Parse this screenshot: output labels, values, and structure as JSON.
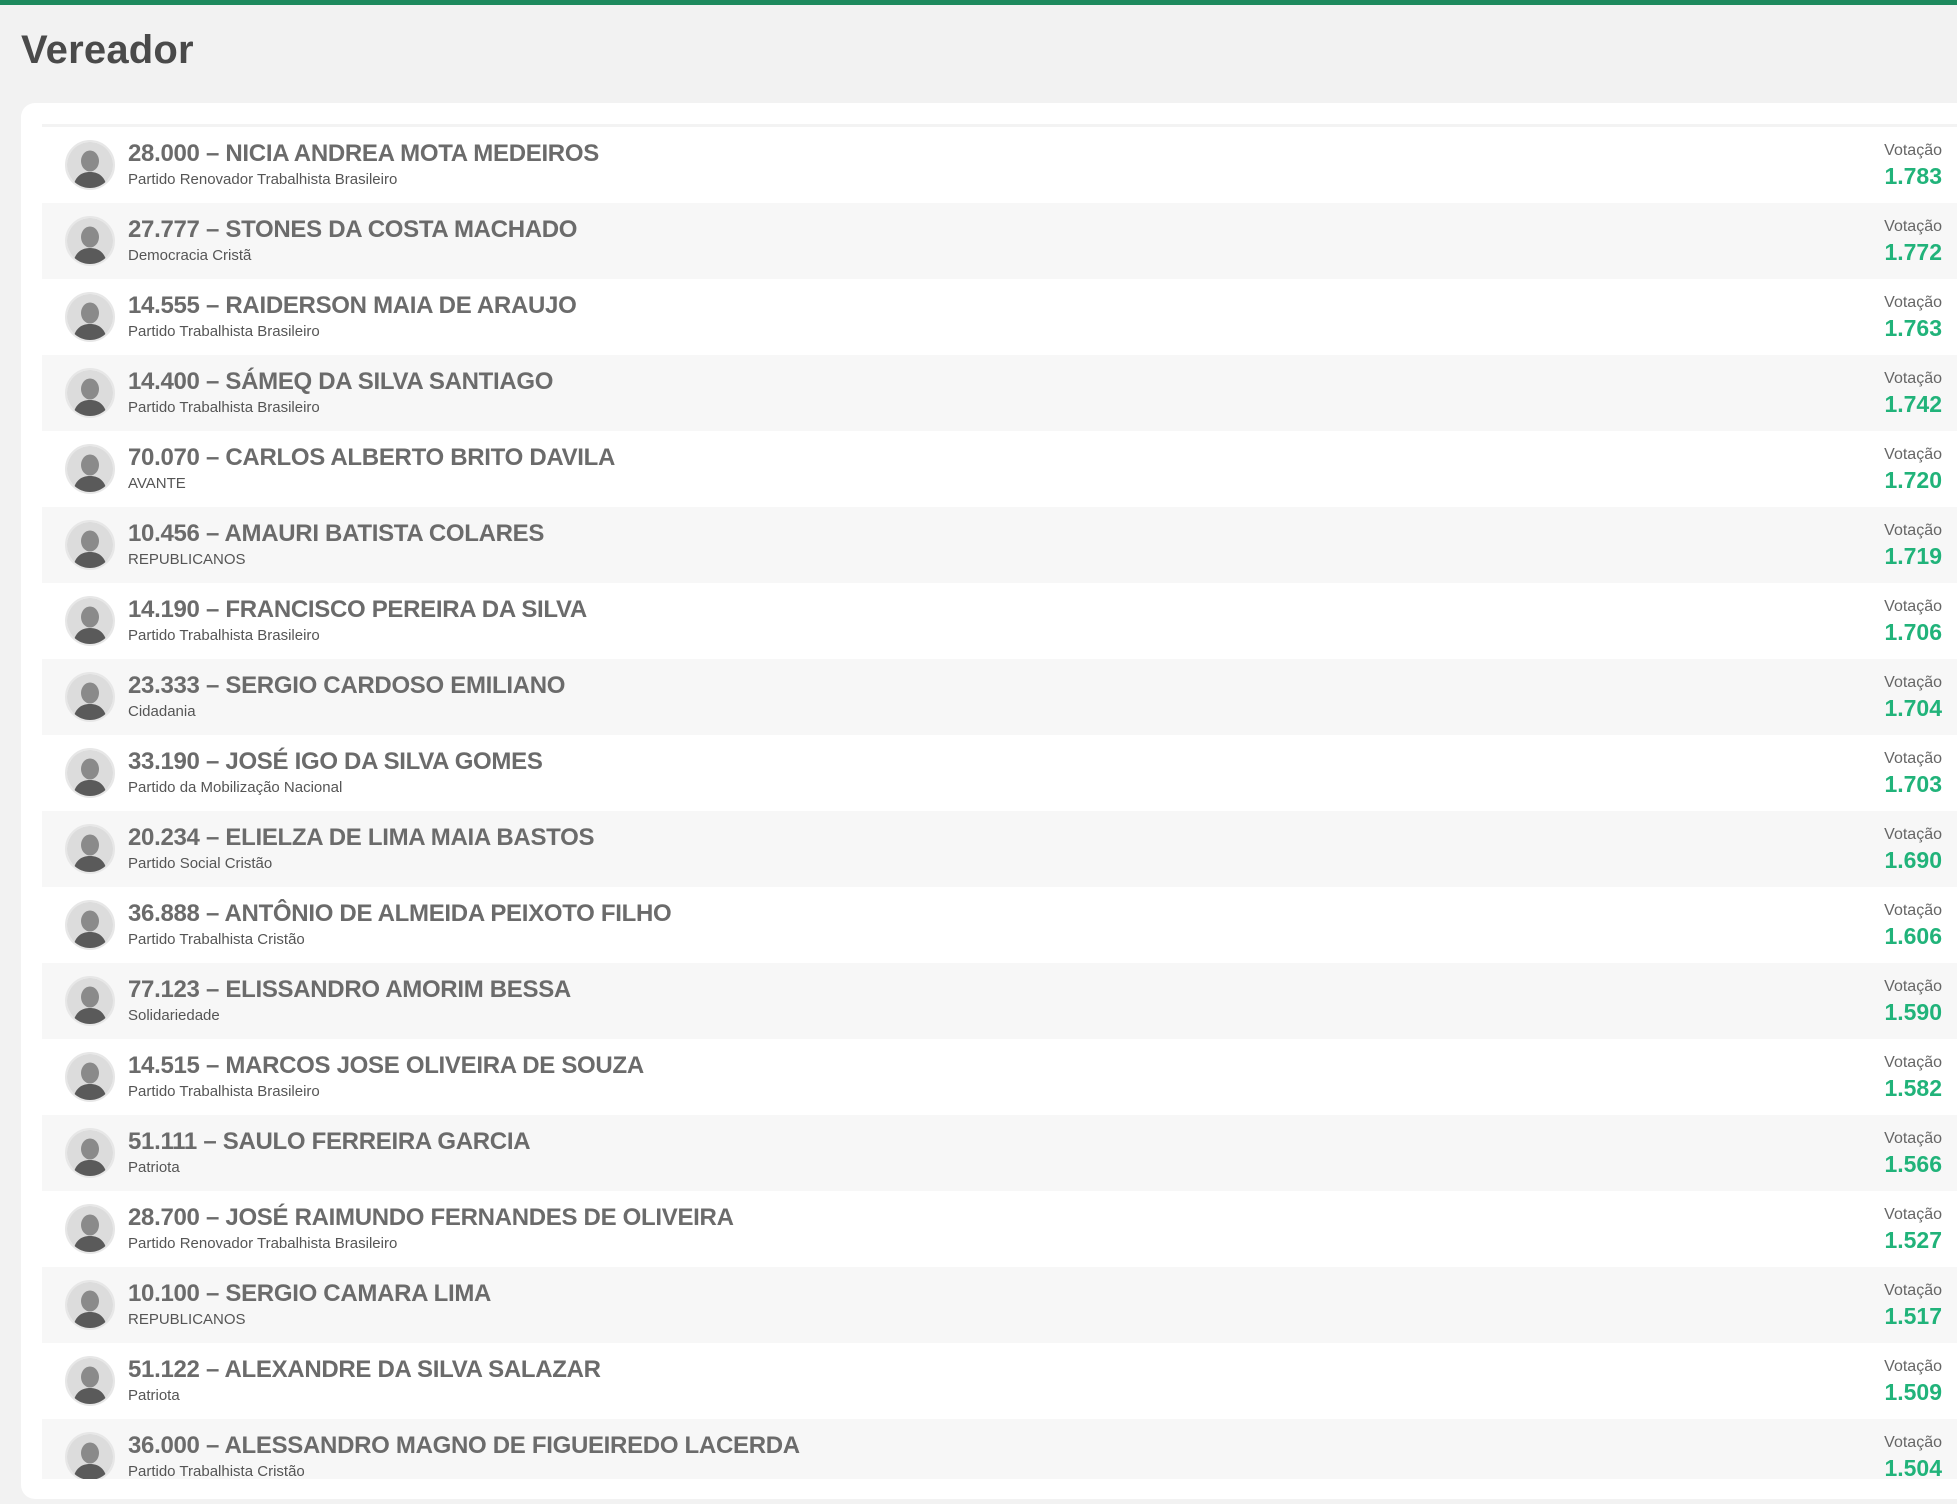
{
  "page": {
    "title": "Vereador"
  },
  "colors": {
    "accent": "#1e8a5e",
    "vote_value": "#21b37a"
  },
  "candidates": [
    {
      "name": "28.000 – NICIA ANDREA MOTA MEDEIROS",
      "party": "Partido Renovador Trabalhista Brasileiro",
      "vote_label": "Votação",
      "votes": "1.783"
    },
    {
      "name": "27.777 – STONES DA COSTA MACHADO",
      "party": "Democracia Cristã",
      "vote_label": "Votação",
      "votes": "1.772"
    },
    {
      "name": "14.555 – RAIDERSON MAIA DE ARAUJO",
      "party": "Partido Trabalhista Brasileiro",
      "vote_label": "Votação",
      "votes": "1.763"
    },
    {
      "name": "14.400 – SÁMEQ DA SILVA SANTIAGO",
      "party": "Partido Trabalhista Brasileiro",
      "vote_label": "Votação",
      "votes": "1.742"
    },
    {
      "name": "70.070 – CARLOS ALBERTO BRITO DAVILA",
      "party": "AVANTE",
      "vote_label": "Votação",
      "votes": "1.720"
    },
    {
      "name": "10.456 – AMAURI BATISTA COLARES",
      "party": "REPUBLICANOS",
      "vote_label": "Votação",
      "votes": "1.719"
    },
    {
      "name": "14.190 – FRANCISCO PEREIRA DA SILVA",
      "party": "Partido Trabalhista Brasileiro",
      "vote_label": "Votação",
      "votes": "1.706"
    },
    {
      "name": "23.333 – SERGIO CARDOSO EMILIANO",
      "party": "Cidadania",
      "vote_label": "Votação",
      "votes": "1.704"
    },
    {
      "name": "33.190 – JOSÉ IGO DA SILVA GOMES",
      "party": "Partido da Mobilização Nacional",
      "vote_label": "Votação",
      "votes": "1.703"
    },
    {
      "name": "20.234 – ELIELZA DE LIMA MAIA BASTOS",
      "party": "Partido Social Cristão",
      "vote_label": "Votação",
      "votes": "1.690"
    },
    {
      "name": "36.888 – ANTÔNIO DE ALMEIDA PEIXOTO FILHO",
      "party": "Partido Trabalhista Cristão",
      "vote_label": "Votação",
      "votes": "1.606"
    },
    {
      "name": "77.123 – ELISSANDRO AMORIM BESSA",
      "party": "Solidariedade",
      "vote_label": "Votação",
      "votes": "1.590"
    },
    {
      "name": "14.515 – MARCOS JOSE OLIVEIRA DE SOUZA",
      "party": "Partido Trabalhista Brasileiro",
      "vote_label": "Votação",
      "votes": "1.582"
    },
    {
      "name": "51.111 – SAULO FERREIRA GARCIA",
      "party": "Patriota",
      "vote_label": "Votação",
      "votes": "1.566"
    },
    {
      "name": "28.700 – JOSÉ RAIMUNDO FERNANDES DE OLIVEIRA",
      "party": "Partido Renovador Trabalhista Brasileiro",
      "vote_label": "Votação",
      "votes": "1.527"
    },
    {
      "name": "10.100 – SERGIO CAMARA LIMA",
      "party": "REPUBLICANOS",
      "vote_label": "Votação",
      "votes": "1.517"
    },
    {
      "name": "51.122 – ALEXANDRE DA SILVA SALAZAR",
      "party": "Patriota",
      "vote_label": "Votação",
      "votes": "1.509"
    },
    {
      "name": "36.000 – ALESSANDRO MAGNO DE FIGUEIREDO LACERDA",
      "party": "Partido Trabalhista Cristão",
      "vote_label": "Votação",
      "votes": "1.504"
    }
  ]
}
